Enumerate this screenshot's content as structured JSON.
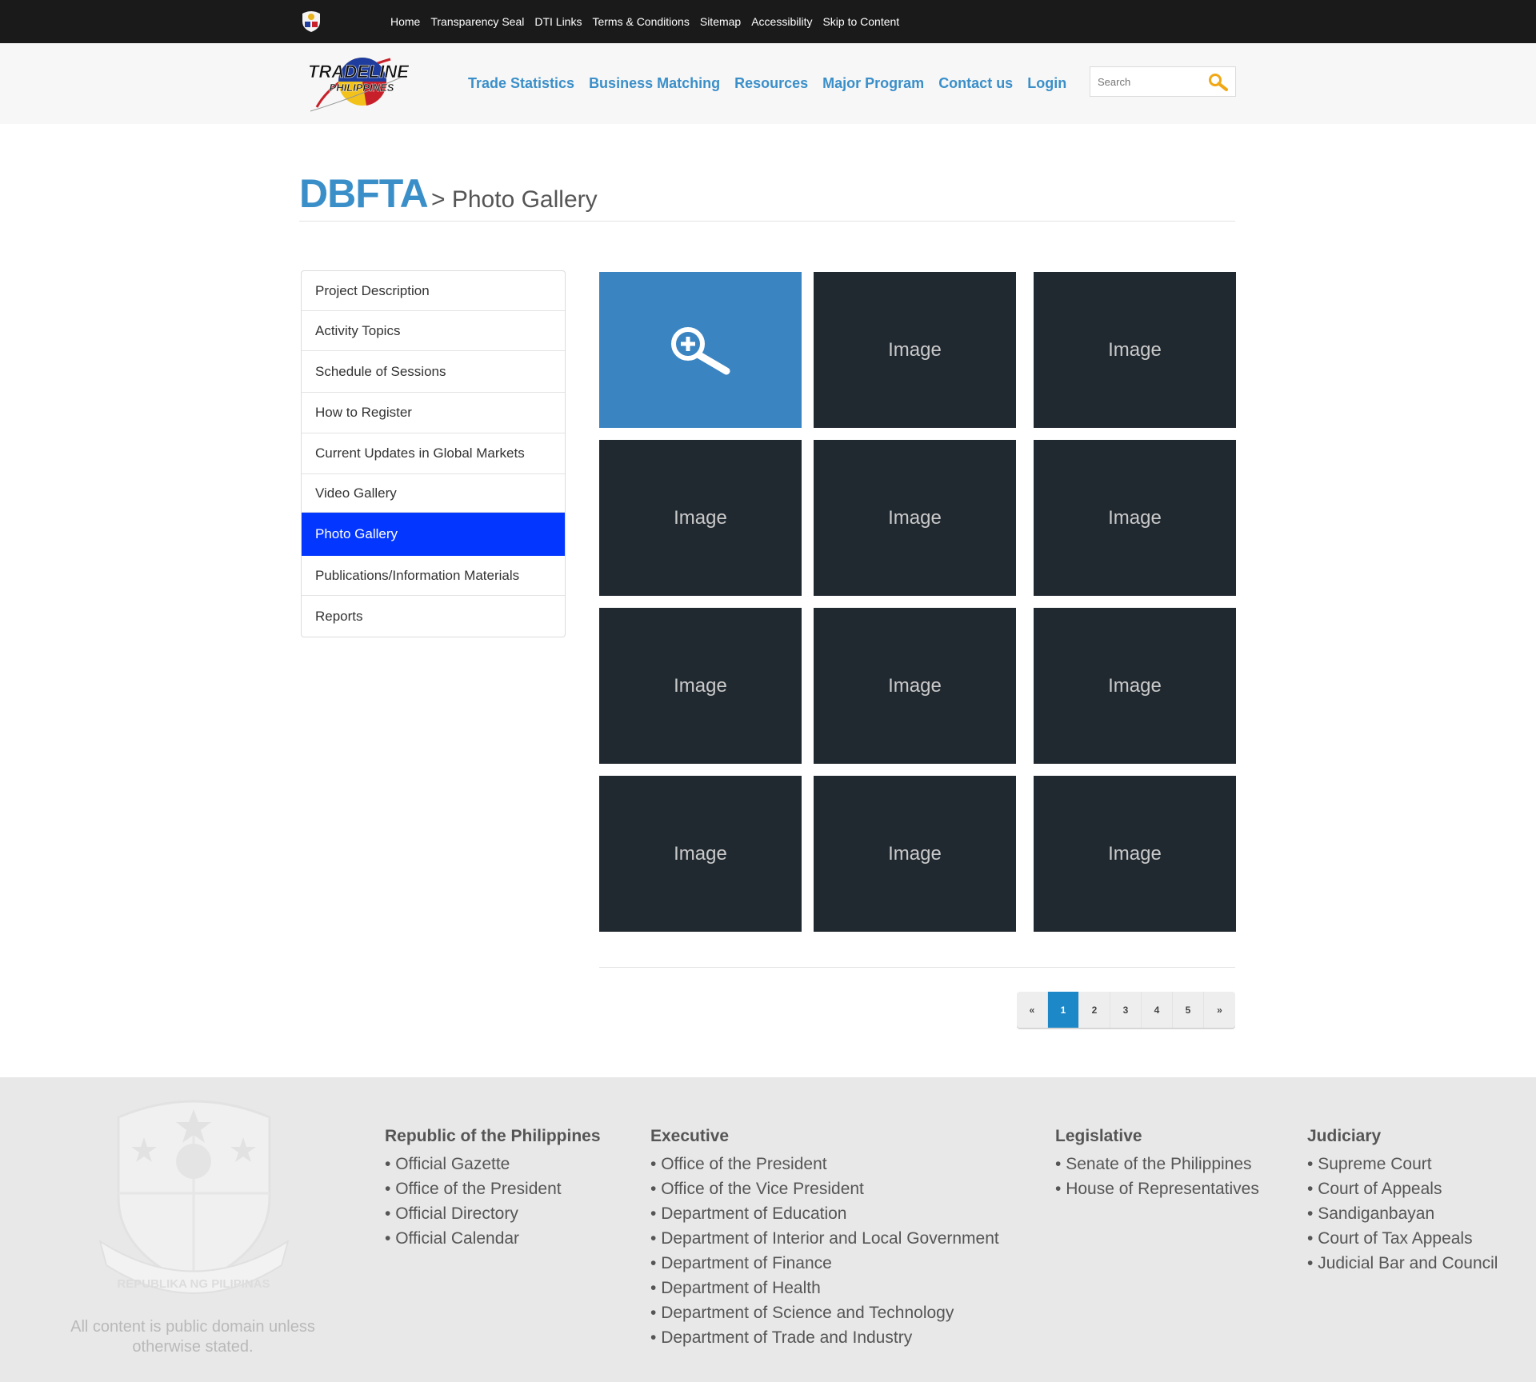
{
  "topbar": {
    "links": [
      "Home",
      "Transparency Seal",
      "DTI Links",
      "Terms & Conditions",
      "Sitemap",
      "Accessibility",
      "Skip to Content"
    ]
  },
  "header": {
    "logo_line1": "TRADELINE",
    "logo_line2": "PHILIPPINES",
    "nav": [
      "Trade Statistics",
      "Business Matching",
      "Resources",
      "Major Program",
      "Contact us",
      "Login"
    ],
    "search_placeholder": "Search"
  },
  "title": {
    "main": "DBFTA",
    "sub": "> Photo Gallery"
  },
  "sidebar": {
    "items": [
      "Project Description",
      "Activity Topics",
      "Schedule of Sessions",
      "How to Register",
      "Current Updates in Global Markets",
      "Video Gallery",
      "Photo Gallery",
      "Publications/Information Materials",
      "Reports"
    ],
    "active_index": 6
  },
  "gallery": {
    "tile_label": "Image",
    "rows": 4,
    "cols": 3
  },
  "pagination": {
    "prev": "«",
    "pages": [
      "1",
      "2",
      "3",
      "4",
      "5"
    ],
    "next": "»",
    "current": "1"
  },
  "footer": {
    "public_domain": "All content is public domain unless otherwise stated.",
    "seal_text": "REPUBLIKA NG PILIPINAS",
    "columns": [
      {
        "heading": "Republic of the Philippines",
        "items": [
          "Official Gazette",
          "Office of the President",
          "Official Directory",
          "Official Calendar"
        ]
      },
      {
        "heading": "Executive",
        "items": [
          "Office of the President",
          "Office of the Vice President",
          "Department of Education",
          "Department of Interior and Local Government",
          "Department of Finance",
          "Department of Health",
          "Department of Science and Technology",
          "Department of Trade and Industry"
        ]
      },
      {
        "heading": "Legislative",
        "items": [
          "Senate of the Philippines",
          "House of Representatives"
        ]
      },
      {
        "heading": "Judiciary",
        "items": [
          "Supreme Court",
          "Court of Appeals",
          "Sandiganbayan",
          "Court of Tax Appeals",
          "Judicial Bar and Council"
        ]
      }
    ]
  },
  "colors": {
    "accent": "#3a8fc9",
    "active_sidebar": "#0336ff",
    "tile": "#212930",
    "featured_tile": "#3b84c2",
    "page_active": "#1d88c7",
    "topbar": "#1b1a1b",
    "footer": "#e8e8e8"
  }
}
